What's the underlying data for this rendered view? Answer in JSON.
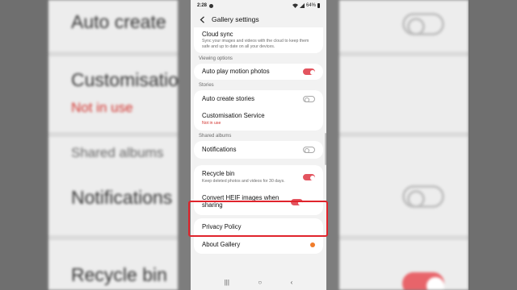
{
  "status_bar": {
    "time": "2:28",
    "battery": "64%"
  },
  "app_bar": {
    "title": "Gallery settings"
  },
  "cloud_sync": {
    "label": "Cloud sync",
    "description": "Sync your images and videos with the cloud to keep them safe and up to date on all your devices."
  },
  "viewing_options": {
    "header": "Viewing options",
    "auto_play": {
      "label": "Auto play motion photos",
      "enabled": true
    }
  },
  "stories": {
    "header": "Stories",
    "auto_create": {
      "label": "Auto create stories",
      "enabled": false
    },
    "customisation": {
      "label": "Customisation Service",
      "status": "Not in use"
    }
  },
  "shared_albums": {
    "header": "Shared albums",
    "notifications": {
      "label": "Notifications",
      "enabled": false
    }
  },
  "recycle_bin": {
    "label": "Recycle bin",
    "description": "Keep deleted photos and videos for 30 days.",
    "enabled": true
  },
  "convert_heif": {
    "label": "Convert HEIF images when sharing",
    "enabled": true
  },
  "privacy_policy": {
    "label": "Privacy Policy"
  },
  "about_gallery": {
    "label": "About Gallery",
    "badge_color": "#f07c2a"
  },
  "nav_bar": {
    "recent": "|||",
    "home": "○",
    "back": "‹"
  },
  "background": {
    "auto_create": "Auto create",
    "customisation": "Customisation",
    "not_in_use": "Not in use",
    "shared_albums": "Shared albums",
    "notifications": "Notifications",
    "recycle_bin": "Recycle bin"
  },
  "colors": {
    "accent_toggle": "#e3545f",
    "highlight_box": "#e0242c",
    "status_red": "#d2322d"
  }
}
